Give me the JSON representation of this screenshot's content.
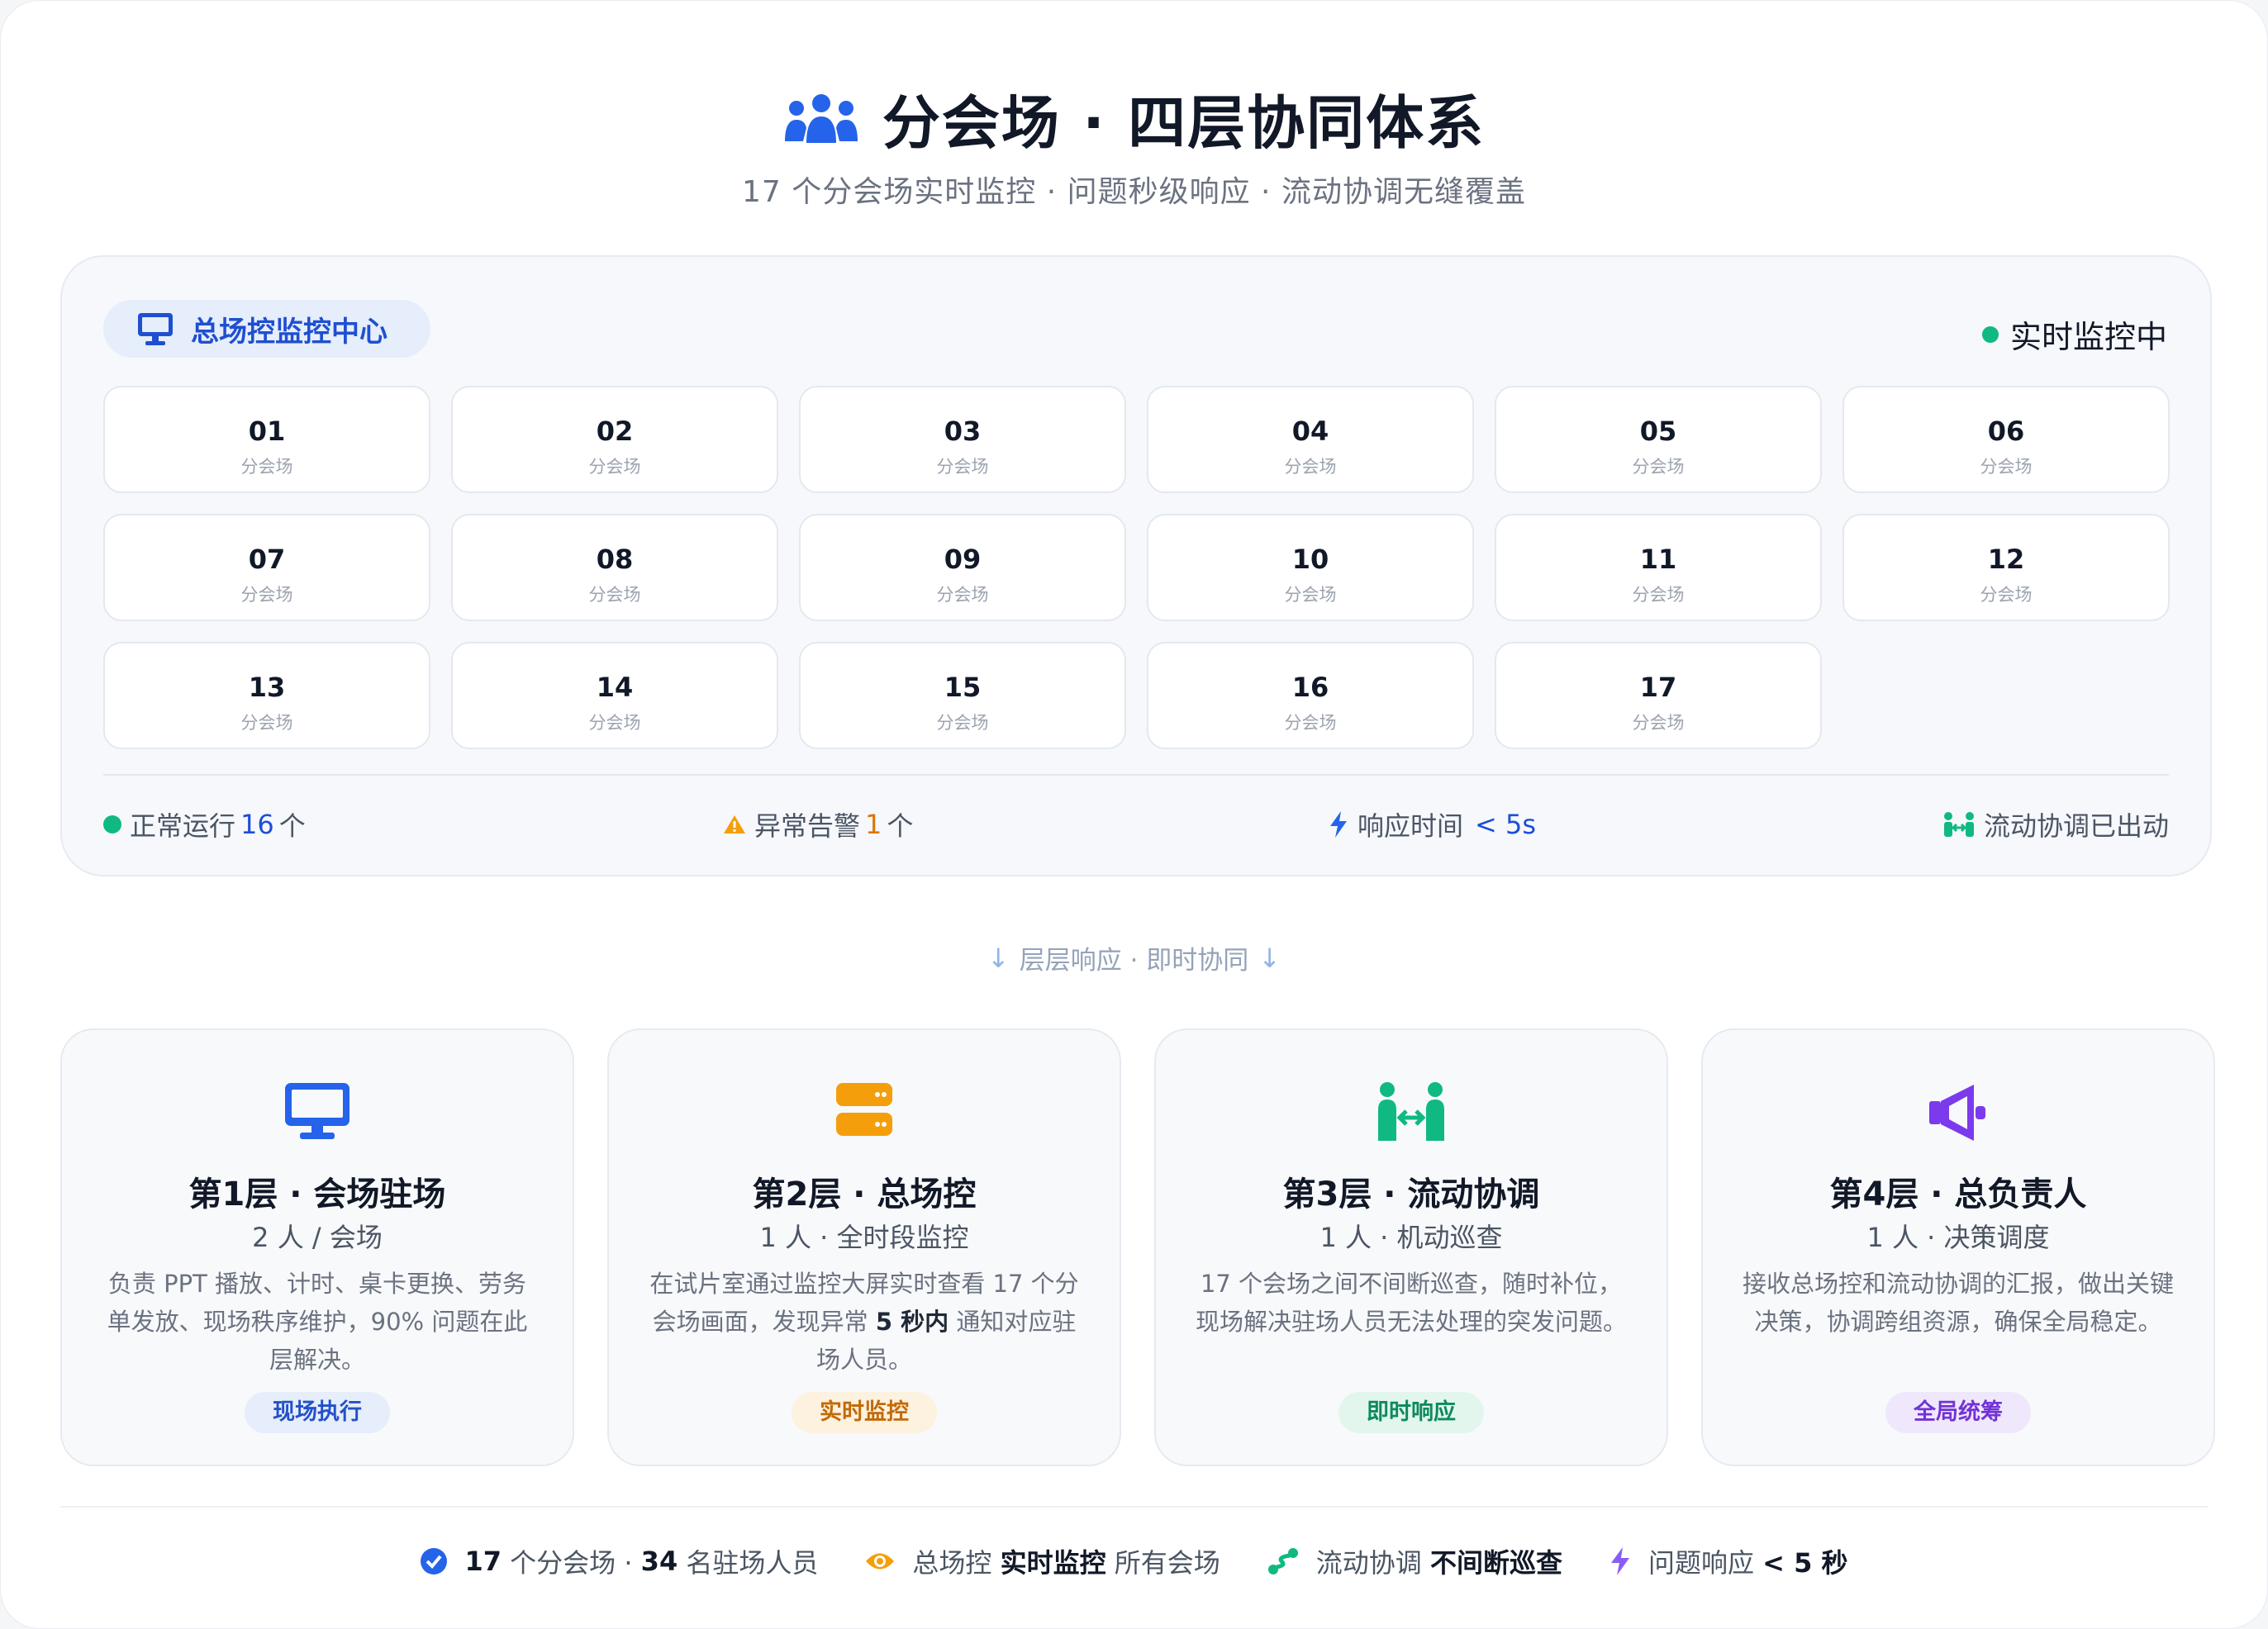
{
  "header": {
    "icon": "users-icon",
    "title": "分会场 · 四层协同体系",
    "subtitle": "17 个分会场实时监控 · 问题秒级响应 · 流动协调无缝覆盖"
  },
  "monitor": {
    "center_label": "总场控监控中心",
    "center_icon": "monitor-icon",
    "live_status": "实时监控中",
    "venues": [
      {
        "num": "01",
        "label": "分会场"
      },
      {
        "num": "02",
        "label": "分会场"
      },
      {
        "num": "03",
        "label": "分会场"
      },
      {
        "num": "04",
        "label": "分会场"
      },
      {
        "num": "05",
        "label": "分会场"
      },
      {
        "num": "06",
        "label": "分会场"
      },
      {
        "num": "07",
        "label": "分会场"
      },
      {
        "num": "08",
        "label": "分会场"
      },
      {
        "num": "09",
        "label": "分会场"
      },
      {
        "num": "10",
        "label": "分会场"
      },
      {
        "num": "11",
        "label": "分会场"
      },
      {
        "num": "12",
        "label": "分会场"
      },
      {
        "num": "13",
        "label": "分会场"
      },
      {
        "num": "14",
        "label": "分会场"
      },
      {
        "num": "15",
        "label": "分会场"
      },
      {
        "num": "16",
        "label": "分会场"
      },
      {
        "num": "17",
        "label": "分会场"
      }
    ],
    "stats": {
      "normal_label": "正常运行",
      "normal_count": "16",
      "normal_unit": "个",
      "alert_label": "异常告警",
      "alert_count": "1",
      "alert_unit": "个",
      "response_label": "响应时间",
      "response_value": "< 5s",
      "mobile_label": "流动协调已出动"
    }
  },
  "flow": {
    "text": "层层响应 · 即时协同"
  },
  "layers": [
    {
      "icon": "desktop-icon",
      "title": "第1层 · 会场驻场",
      "sub": "2 人 / 会场",
      "desc": "负责 PPT 播放、计时、桌卡更换、劳务单发放、现场秩序维护，90% 问题在此层解决。",
      "tag": "现场执行",
      "color": "#2563eb"
    },
    {
      "icon": "server-icon",
      "title": "第2层 · 总场控",
      "sub": "1 人 · 全时段监控",
      "desc_pre": "在试片室通过监控大屏实时查看 17 个分会场画面，发现异常 ",
      "desc_bold": "5 秒内",
      "desc_post": " 通知对应驻场人员。",
      "tag": "实时监控",
      "color": "#f59e0b"
    },
    {
      "icon": "people-arrows-icon",
      "title": "第3层 · 流动协调",
      "sub": "1 人 · 机动巡查",
      "desc": "17 个会场之间不间断巡查，随时补位，现场解决驻场人员无法处理的突发问题。",
      "tag": "即时响应",
      "color": "#10b981"
    },
    {
      "icon": "bullhorn-icon",
      "title": "第4层 · 总负责人",
      "sub": "1 人 · 决策调度",
      "desc": "接收总场控和流动协调的汇报，做出关键决策，协调跨组资源，确保全局稳定。",
      "tag": "全局统筹",
      "color": "#7c3aed"
    }
  ],
  "footer": {
    "item1_num1": "17",
    "item1_mid": " 个分会场 · ",
    "item1_num2": "34",
    "item1_tail": " 名驻场人员",
    "item2_pre": "总场控 ",
    "item2_bold": "实时监控",
    "item2_post": " 所有会场",
    "item3_pre": "流动协调 ",
    "item3_bold": "不间断巡查",
    "item4_pre": "问题响应 ",
    "item4_bold": "< 5 秒"
  }
}
